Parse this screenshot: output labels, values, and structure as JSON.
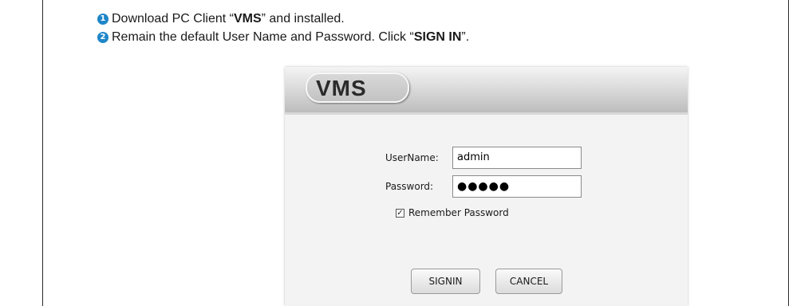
{
  "instructions": {
    "step1": {
      "number": "1",
      "text_before": "Download PC Client “",
      "bold": "VMS",
      "text_after": "” and installed."
    },
    "step2": {
      "number": "2",
      "text_before": "Remain the default User Name and Password. Click “",
      "bold": "SIGN IN",
      "text_after": "”."
    },
    "badge_color": "#1e86c8"
  },
  "login": {
    "logo": "VMS",
    "username_label": "UserName:",
    "username_value": "admin",
    "password_label": "Password:",
    "password_masked": "●●●●●",
    "remember_label": "Remember Password",
    "remember_checked": true,
    "check_mark": "✓",
    "signin_label": "SIGNIN",
    "cancel_label": "CANCEL"
  }
}
